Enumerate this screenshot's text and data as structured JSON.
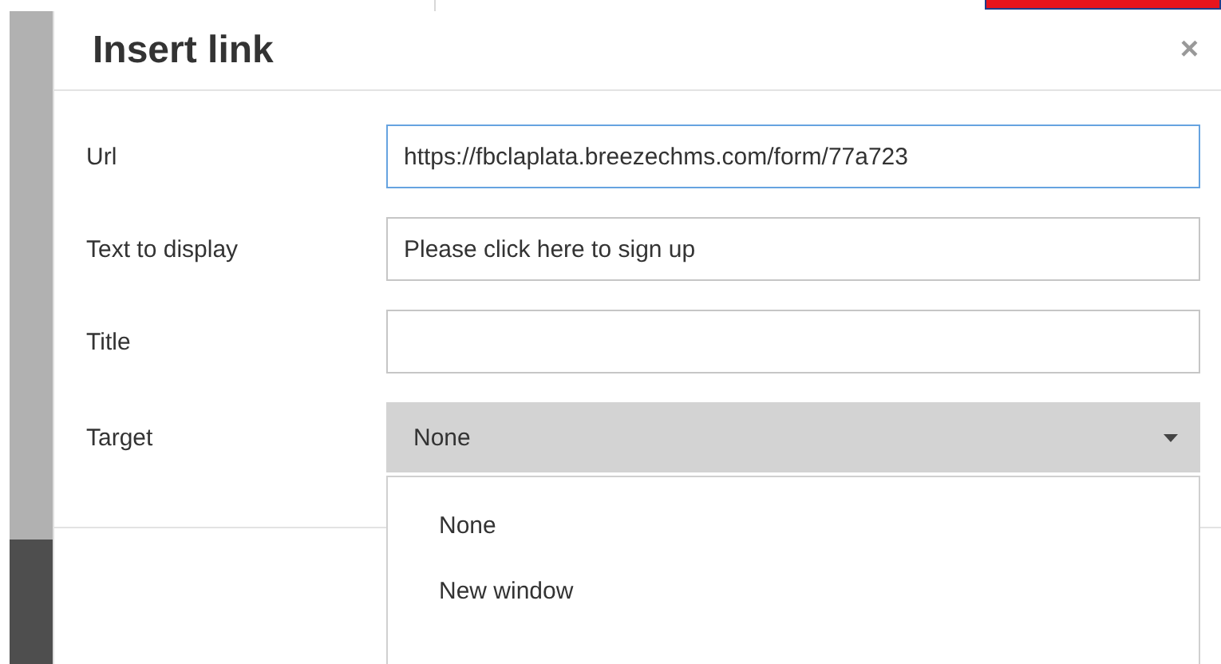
{
  "dialog": {
    "title": "Insert link",
    "close": "×"
  },
  "fields": [
    {
      "label": "Url",
      "kind": "text",
      "value": "https://fbclaplata.breezechms.com/form/77a723",
      "focused": true
    },
    {
      "label": "Text to display",
      "kind": "text",
      "value": "Please click here to sign up",
      "focused": false
    },
    {
      "label": "Title",
      "kind": "text",
      "focused": false
    },
    {
      "label": "Target",
      "kind": "select",
      "value": "None",
      "expanded": true,
      "options": [
        "None",
        "New window"
      ]
    }
  ]
}
